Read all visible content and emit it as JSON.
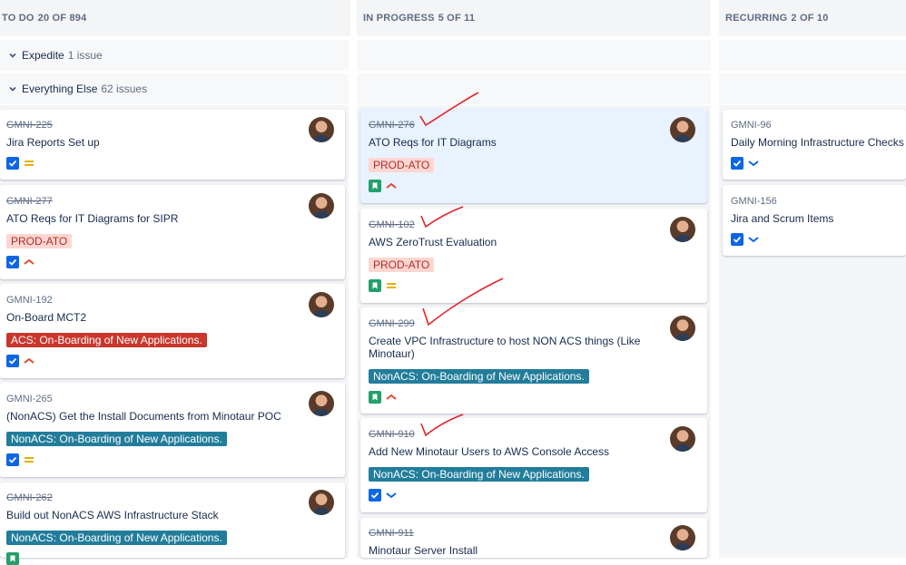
{
  "columns": [
    {
      "title": "TO DO",
      "count": "20 OF 894"
    },
    {
      "title": "IN PROGRESS",
      "count": "5 OF 11"
    },
    {
      "title": "RECURRING",
      "count": "2 OF 10"
    }
  ],
  "swimlanes": [
    {
      "label": "Expedite",
      "count": "1 issue"
    },
    {
      "label": "Everything Else",
      "count": "62 issues"
    }
  ],
  "todo": [
    {
      "key": "GMNI-225",
      "title": "Jira Reports Set up",
      "label": "",
      "type": "task",
      "priority": "medium"
    },
    {
      "key": "GMNI-277",
      "title": "ATO Reqs for IT Diagrams for SIPR",
      "label": "PROD-ATO",
      "type": "task",
      "priority": "high"
    },
    {
      "key": "GMNI-192",
      "title": "On-Board MCT2",
      "label": "ACS: On-Boarding of New Applications.",
      "type": "task",
      "priority": "high"
    },
    {
      "key": "GMNI-265",
      "title": "(NonACS) Get the Install Documents from Minotaur POC",
      "label": "NonACS: On-Boarding of New Applications.",
      "type": "task",
      "priority": "medium"
    },
    {
      "key": "GMNI-262",
      "title": "Build out NonACS AWS Infrastructure Stack",
      "label": "NonACS: On-Boarding of New Applications.",
      "type": "story",
      "priority": ""
    }
  ],
  "inprogress": [
    {
      "key": "GMNI-276",
      "title": "ATO Reqs for IT Diagrams",
      "label": "PROD-ATO",
      "type": "story",
      "priority": "high"
    },
    {
      "key": "GMNI-102",
      "title": "AWS ZeroTrust Evaluation",
      "label": "PROD-ATO",
      "type": "story",
      "priority": "medium"
    },
    {
      "key": "GMNI-299",
      "title": "Create VPC Infrastructure to host NON ACS things (Like Minotaur)",
      "label": "NonACS: On-Boarding of New Applications.",
      "type": "story",
      "priority": "high"
    },
    {
      "key": "GMNI-910",
      "title": "Add New Minotaur Users to AWS Console Access",
      "label": "NonACS: On-Boarding of New Applications.",
      "type": "task",
      "priority": "low"
    },
    {
      "key": "GMNI-911",
      "title": "Minotaur Server Install",
      "label": "",
      "type": "",
      "priority": ""
    }
  ],
  "recurring": [
    {
      "key": "GMNI-96",
      "title": "Daily Morning Infrastructure Checks",
      "type": "task",
      "priority": "low"
    },
    {
      "key": "GMNI-156",
      "title": "Jira and Scrum Items",
      "type": "task",
      "priority": "low"
    }
  ],
  "colors": {
    "accent": "#0c66e4",
    "story": "#22a06b",
    "high": "#e34935",
    "medium": "#e2b203",
    "low": "#0c66e4",
    "annotation": "#e2252b"
  }
}
